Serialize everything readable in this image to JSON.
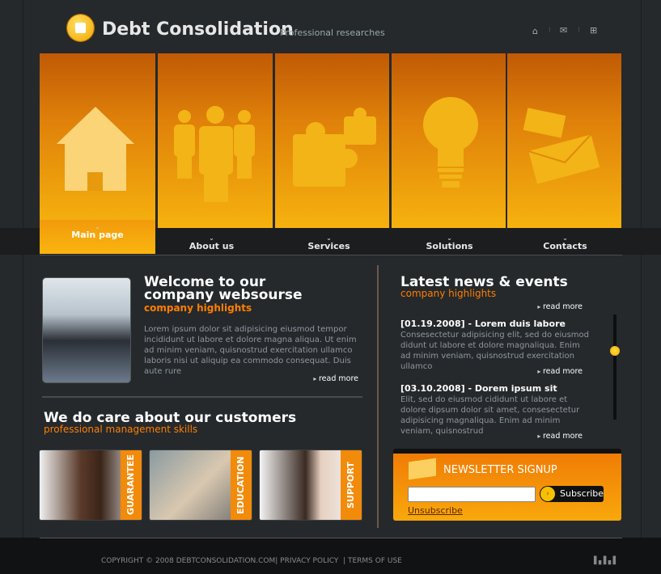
{
  "header": {
    "title": "Debt Consolidation",
    "tagline": "Professional researches",
    "icons": [
      "home-icon",
      "mail-icon",
      "sitemap-icon"
    ]
  },
  "nav": [
    {
      "label": "Main page",
      "active": true
    },
    {
      "label": "About us"
    },
    {
      "label": "Services"
    },
    {
      "label": "Solutions"
    },
    {
      "label": "Contacts"
    }
  ],
  "welcome": {
    "title1": "Welcome to our",
    "title2": "company websourse",
    "subtitle": "company highlights",
    "text": "Lorem ipsum dolor sit adipisicing  eiusmod tempor incididunt ut labore et dolore magna aliqua. Ut enim ad minim veniam, quisnostrud exercitation ullamco laboris nisi ut aliquip ea commodo consequat. Duis aute rure",
    "read_more": "read more"
  },
  "care": {
    "title": "We do care about our customers",
    "subtitle": "professional management skills",
    "cards": [
      "GUARANTEE",
      "EDUCATION",
      "SUPPORT"
    ]
  },
  "news": {
    "title": "Latest news & events",
    "subtitle": "company highlights",
    "read_more": "read more",
    "items": [
      {
        "title": "[01.19.2008] - Lorem duis labore",
        "text": "Consesectetur adipisicing elit, sed do eiusmod didunt ut labore et dolore magnaliqua. Enim ad minim veniam, quisnostrud exercitation ullamco"
      },
      {
        "title": "[03.10.2008] - Dorem ipsum sit",
        "text": "Elit, sed do eiusmod cididunt ut labore et dolore dipsum dolor sit amet, consesectetur adipisicing magnaliqua. Enim ad minim veniam, quisnostrud"
      }
    ]
  },
  "newsletter": {
    "title": "NEWSLETTER SIGNUP",
    "input_value": "",
    "subscribe": "Subscribe",
    "unsubscribe": "Unsubscribe"
  },
  "footer": {
    "copyright": "COPYRIGHT © 2008  DEBTCONSOLIDATION.COM",
    "privacy": "PRIVACY POLICY",
    "terms": "TERMS OF USE"
  },
  "colors": {
    "accent": "#ff7e00",
    "background": "#25292c",
    "banner": "#f6b20e"
  }
}
